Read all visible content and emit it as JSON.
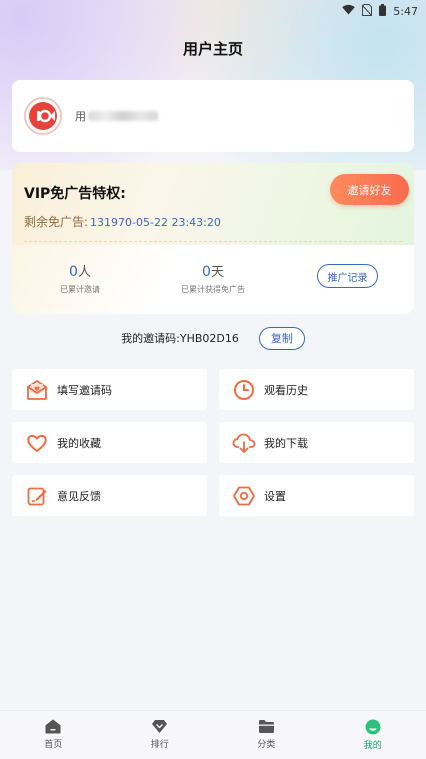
{
  "status_bar": {
    "time": "5:47"
  },
  "page": {
    "title": "用户主页"
  },
  "user": {
    "name_prefix": "用"
  },
  "vip": {
    "title": "VIP免广告特权:",
    "invite_button": "邀请好友",
    "remaining_label": "剩余免广告:",
    "remaining_value": "131970-05-22 23:43:20",
    "invited_count": "0",
    "invited_unit": "人",
    "invited_label": "已累计邀请",
    "ad_free_days": "0",
    "ad_free_unit": "天",
    "ad_free_label": "已累计获得免广告",
    "record_button": "推广记录"
  },
  "invite_code": {
    "label": "我的邀请码:",
    "value": "YHB02D16",
    "copy_button": "复制"
  },
  "menu": {
    "fill_code": "填写邀请码",
    "history": "观看历史",
    "favorites": "我的收藏",
    "downloads": "我的下载",
    "feedback": "意见反馈",
    "settings": "设置"
  },
  "tabs": [
    {
      "label": "首页"
    },
    {
      "label": "排行"
    },
    {
      "label": "分类"
    },
    {
      "label": "我的"
    }
  ],
  "colors": {
    "accent": "#3a66c8",
    "invite_btn": "#f76b4d",
    "icon_orange": "#f26a3d",
    "tab_active": "#1a9e6b"
  }
}
